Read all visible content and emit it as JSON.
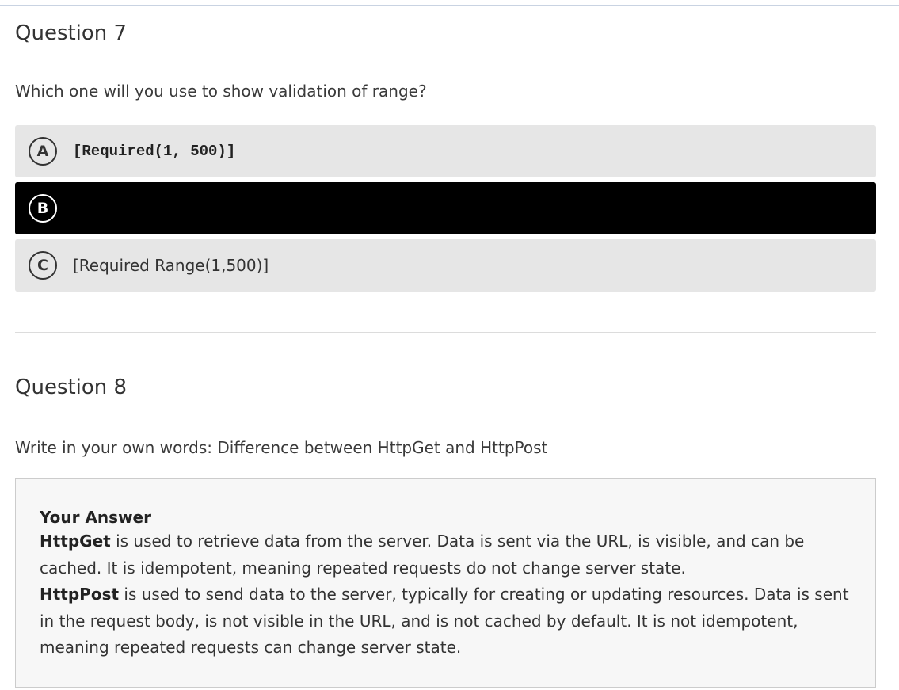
{
  "question7": {
    "title": "Question 7",
    "prompt": "Which one will you use to show validation of range?",
    "options": [
      {
        "letter": "A",
        "text": "[Required(1, 500)]",
        "selected": false
      },
      {
        "letter": "B",
        "text": "",
        "selected": true
      },
      {
        "letter": "C",
        "text": "[Required Range(1,500)]",
        "selected": false
      }
    ]
  },
  "question8": {
    "title": "Question 8",
    "prompt": "Write in your own words: Difference between HttpGet and HttpPost",
    "answer": {
      "heading": "Your Answer",
      "paragraphs": [
        {
          "term": "HttpGet",
          "text": " is used to retrieve data from the server. Data is sent via the URL, is visible, and can be cached. It is idempotent, meaning repeated requests do not change server state."
        },
        {
          "term": "HttpPost",
          "text": " is used to send data to the server, typically for creating or updating resources. Data is sent in the request body, is not visible in the URL, and is not cached by default. It is not idempotent, meaning repeated requests can change server state."
        }
      ]
    }
  },
  "colors": {
    "option_bg": "#e6e6e6",
    "option_selected_bg": "#000000",
    "answer_bg": "#f7f7f7",
    "text": "#333333"
  }
}
